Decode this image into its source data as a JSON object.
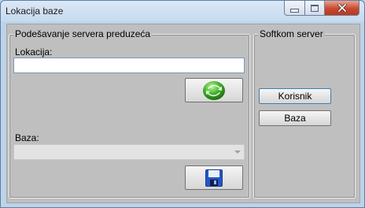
{
  "window": {
    "title": "Lokacija baze"
  },
  "left_group": {
    "legend": "Podešavanje servera preduzeća",
    "location_label": "Lokacija:",
    "location_value": "",
    "database_label": "Baza:",
    "database_value": ""
  },
  "right_group": {
    "legend": "Softkom server",
    "user_button": "Korisnik",
    "database_button": "Baza"
  },
  "icons": {
    "connect": "green-refresh-orb-icon",
    "save": "floppy-disk-icon"
  }
}
